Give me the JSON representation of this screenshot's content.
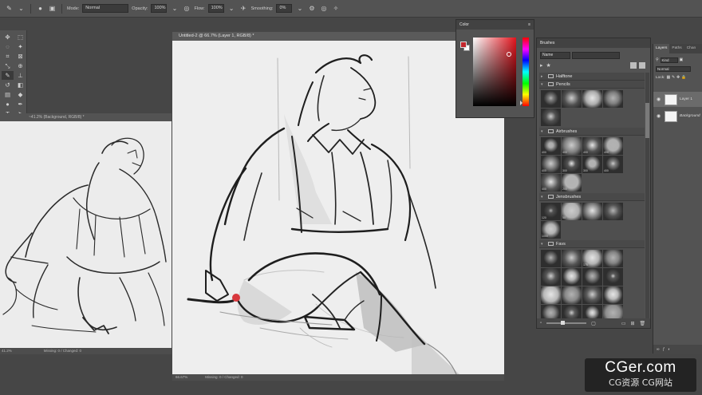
{
  "options_bar": {
    "mode_label": "Mode:",
    "mode_value": "Normal",
    "opacity_label": "Opacity:",
    "opacity_value": "100%",
    "flow_label": "Flow:",
    "flow_value": "100%",
    "smoothing_label": "Smoothing:",
    "smoothing_value": "0%"
  },
  "colors": {
    "foreground": "#c2272d",
    "background": "#ffffff"
  },
  "document_secondary": {
    "tab_title": "~41.2% (Background, RGB/8) *",
    "zoom": "41.2%",
    "status": "Missing: 0 / Changed: 0"
  },
  "document_main": {
    "tab_title": "Untitled-2 @ 66.7% (Layer 1, RGB/8) *",
    "zoom": "66.67%",
    "status": "Missing: 0 / Changed: 0"
  },
  "color_panel": {
    "title": "Color"
  },
  "brushes_panel": {
    "title": "Brushes",
    "search_placeholder": "Name",
    "groups": [
      {
        "name": "Halftone",
        "thumbs": []
      },
      {
        "name": "Pencils",
        "thumbs": [
          "",
          "",
          "",
          "",
          ""
        ]
      },
      {
        "name": "Airbrushes",
        "thumbs": [
          "400",
          "400",
          "400",
          "400",
          "400",
          "300",
          "300",
          "400",
          "400",
          "200"
        ]
      },
      {
        "name": "Jensbrushes",
        "thumbs": [
          "120",
          "50",
          "",
          "",
          "1000"
        ]
      },
      {
        "name": "Favs",
        "thumbs": [
          "",
          "",
          "175",
          "",
          "",
          "",
          "",
          "",
          "",
          "",
          "",
          "",
          "",
          "",
          "",
          "",
          "",
          "",
          "",
          ""
        ]
      }
    ]
  },
  "layers_panel": {
    "tabs": [
      "Layers",
      "Paths",
      "Chan"
    ],
    "kind_label": "Kind",
    "blend_mode": "Normal",
    "lock_label": "Lock:",
    "layers": [
      {
        "name": "Layer 1",
        "selected": true
      },
      {
        "name": "Background",
        "selected": false
      }
    ]
  },
  "watermark": {
    "main": "CGer.com",
    "sub": "CG资源 CG网站"
  }
}
